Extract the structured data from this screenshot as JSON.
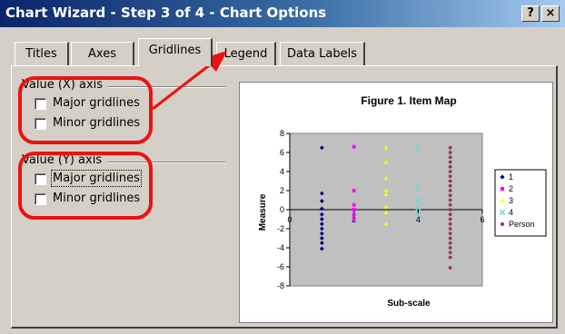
{
  "window": {
    "title": "Chart Wizard - Step 3 of 4 - Chart Options",
    "help_label": "?",
    "close_label": "×"
  },
  "tabs": [
    {
      "label": "Titles"
    },
    {
      "label": "Axes"
    },
    {
      "label": "Gridlines",
      "active": true
    },
    {
      "label": "Legend"
    },
    {
      "label": "Data Labels"
    }
  ],
  "x_axis_group": {
    "label": "Value (X) axis",
    "major": {
      "label": "Major gridlines",
      "checked": false
    },
    "minor": {
      "label": "Minor gridlines",
      "checked": false
    }
  },
  "y_axis_group": {
    "label": "Value (Y) axis",
    "major": {
      "label": "Major gridlines",
      "checked": false
    },
    "minor": {
      "label": "Minor gridlines",
      "checked": false
    }
  },
  "annotation": {
    "color": "#ee1111"
  },
  "chart_data": {
    "type": "scatter",
    "title": "Figure 1. Item Map",
    "xlabel": "Sub-scale",
    "ylabel": "Measure",
    "xlim": [
      0,
      6
    ],
    "ylim": [
      -8,
      8
    ],
    "x_ticks": [
      0,
      2,
      4,
      6
    ],
    "y_ticks": [
      8,
      6,
      4,
      2,
      0,
      -2,
      -4,
      -6,
      -8
    ],
    "grid": false,
    "legend_position": "right",
    "plot_bg": "#c0c0c0",
    "series": [
      {
        "name": "1",
        "color": "#000080",
        "marker": "diamond",
        "points": [
          [
            1,
            6.5
          ],
          [
            1,
            1.7
          ],
          [
            1,
            0.9
          ],
          [
            1,
            0.1
          ],
          [
            1,
            -0.5
          ],
          [
            1,
            -1.0
          ],
          [
            1,
            -1.5
          ],
          [
            1,
            -2.0
          ],
          [
            1,
            -2.5
          ],
          [
            1,
            -3.0
          ],
          [
            1,
            -3.5
          ],
          [
            1,
            -4.1
          ]
        ]
      },
      {
        "name": "2",
        "color": "#ff00ff",
        "marker": "square",
        "points": [
          [
            2,
            6.6
          ],
          [
            2,
            2.0
          ],
          [
            2,
            0.5
          ],
          [
            2,
            0.0
          ],
          [
            2,
            -0.5
          ],
          [
            2,
            -1.0
          ]
        ]
      },
      {
        "name": "3",
        "color": "#ffff00",
        "marker": "triangle",
        "points": [
          [
            3,
            6.5
          ],
          [
            3,
            5.0
          ],
          [
            3,
            3.3
          ],
          [
            3,
            2.0
          ],
          [
            3,
            1.6
          ],
          [
            3,
            0.3
          ],
          [
            3,
            -0.3
          ],
          [
            3,
            -1.5
          ]
        ]
      },
      {
        "name": "4",
        "color": "#66dddd",
        "marker": "x",
        "points": [
          [
            4,
            6.5
          ],
          [
            4,
            2.3
          ],
          [
            4,
            1.0
          ],
          [
            4,
            0.2
          ],
          [
            4,
            -0.5
          ]
        ]
      },
      {
        "name": "Person",
        "color": "#993366",
        "marker": "circle",
        "points": [
          [
            5,
            6.5
          ],
          [
            5,
            6.0
          ],
          [
            5,
            5.5
          ],
          [
            5,
            5.0
          ],
          [
            5,
            4.5
          ],
          [
            5,
            4.0
          ],
          [
            5,
            3.5
          ],
          [
            5,
            3.0
          ],
          [
            5,
            2.5
          ],
          [
            5,
            2.0
          ],
          [
            5,
            1.5
          ],
          [
            5,
            1.0
          ],
          [
            5,
            0.5
          ],
          [
            5,
            0.0
          ],
          [
            5,
            -0.5
          ],
          [
            5,
            -1.0
          ],
          [
            5,
            -1.5
          ],
          [
            5,
            -2.0
          ],
          [
            5,
            -2.5
          ],
          [
            5,
            -3.0
          ],
          [
            5,
            -3.5
          ],
          [
            5,
            -4.0
          ],
          [
            5,
            -4.5
          ],
          [
            5,
            -5.0
          ],
          [
            5,
            -6.1
          ]
        ]
      }
    ]
  }
}
